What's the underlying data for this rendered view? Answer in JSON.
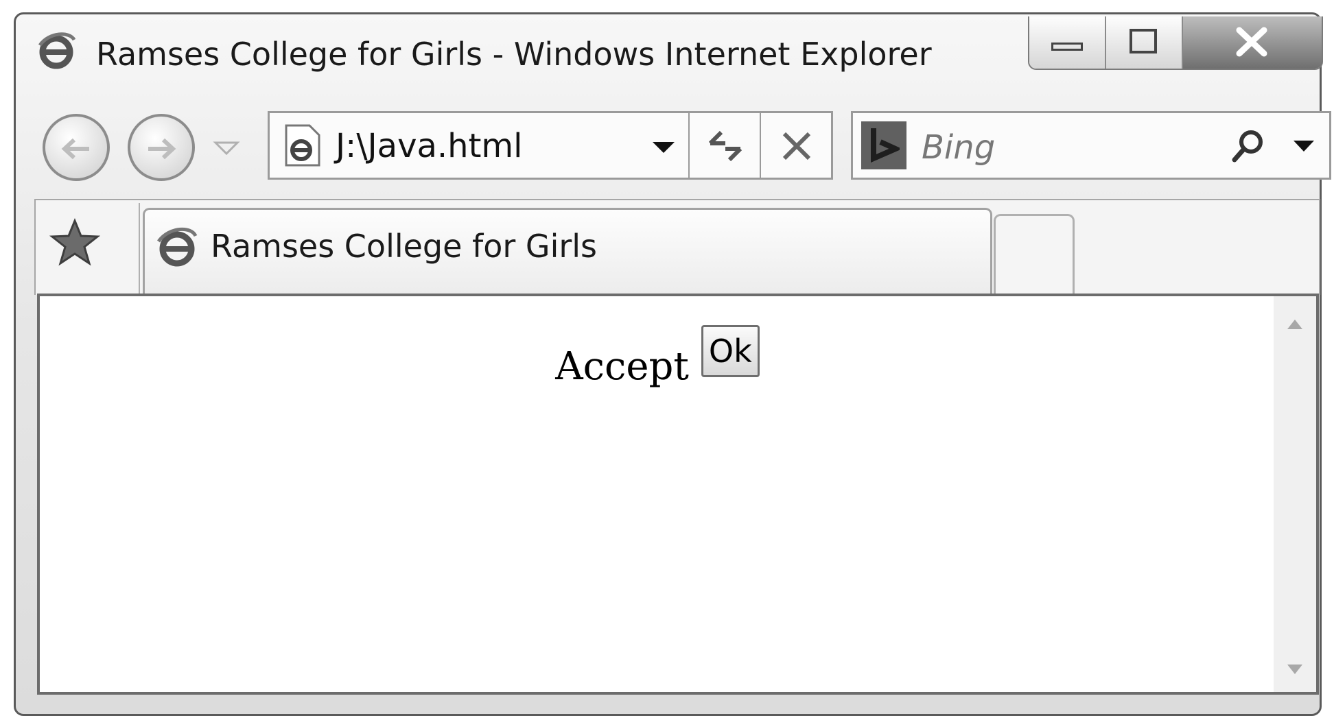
{
  "window": {
    "title": "Ramses College for Girls - Windows Internet Explorer"
  },
  "caption_buttons": {
    "icons": [
      "minimize-icon",
      "maximize-icon",
      "close-icon"
    ]
  },
  "navigation": {
    "address": "J:\\Java.html",
    "search_placeholder": "Bing"
  },
  "tabs": [
    {
      "label": "Ramses College for Girls",
      "active": true
    }
  ],
  "page": {
    "label": "Accept",
    "button_label": "Ok"
  },
  "colors": {
    "frame": "#5a5a5a",
    "chrome": "#e6e6e6",
    "content_bg": "#ffffff"
  }
}
